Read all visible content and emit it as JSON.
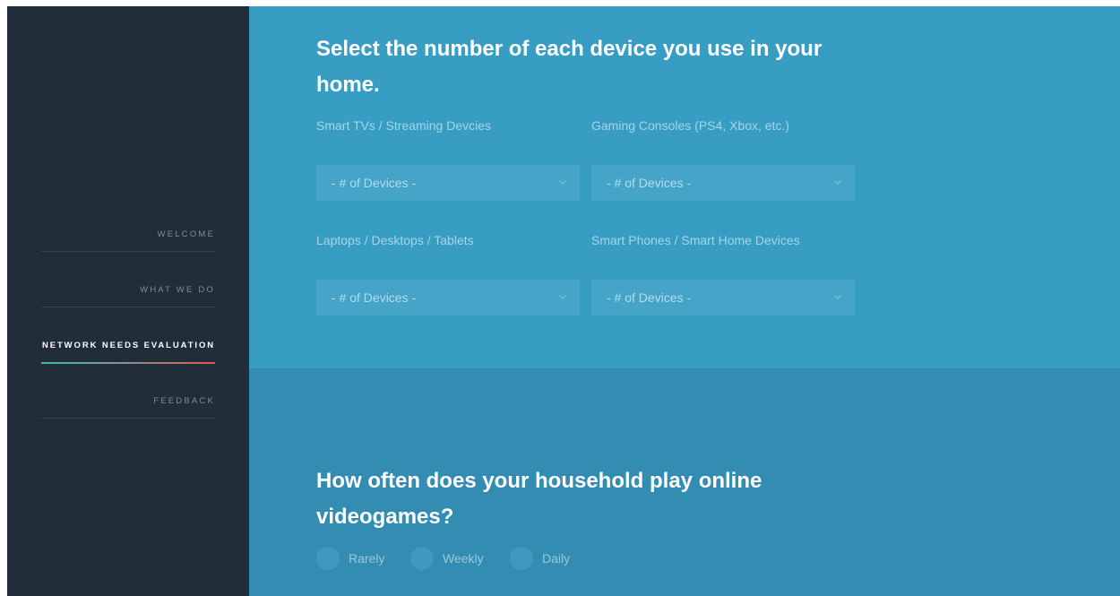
{
  "nav": {
    "items": [
      {
        "label": "WELCOME",
        "active": false
      },
      {
        "label": "WHAT WE DO",
        "active": false
      },
      {
        "label": "NETWORK NEEDS EVALUATION",
        "active": true
      },
      {
        "label": "FEEDBACK",
        "active": false
      }
    ]
  },
  "devices": {
    "heading": "Select the number of each device you use in your home.",
    "fields": [
      {
        "label": "Smart TVs / Streaming Devcies",
        "value": "- # of Devices -"
      },
      {
        "label": "Gaming Consoles (PS4, Xbox, etc.)",
        "value": "- # of Devices -"
      },
      {
        "label": "Laptops / Desktops / Tablets",
        "value": "- # of Devices -"
      },
      {
        "label": "Smart Phones / Smart Home Devices",
        "value": "- # of Devices -"
      }
    ]
  },
  "gaming": {
    "heading": "How often does your household play online videogames?",
    "options": [
      "Rarely",
      "Weekly",
      "Daily"
    ]
  },
  "icons": {
    "select_arrow": "chevron-down-icon"
  },
  "colors": {
    "sidebar_bg": "#222d3a",
    "devices_section_bg": "#389dc3",
    "gaming_section_bg": "#338db3",
    "active_underline_start": "#3dbb9a",
    "active_underline_end": "#e0594f"
  }
}
